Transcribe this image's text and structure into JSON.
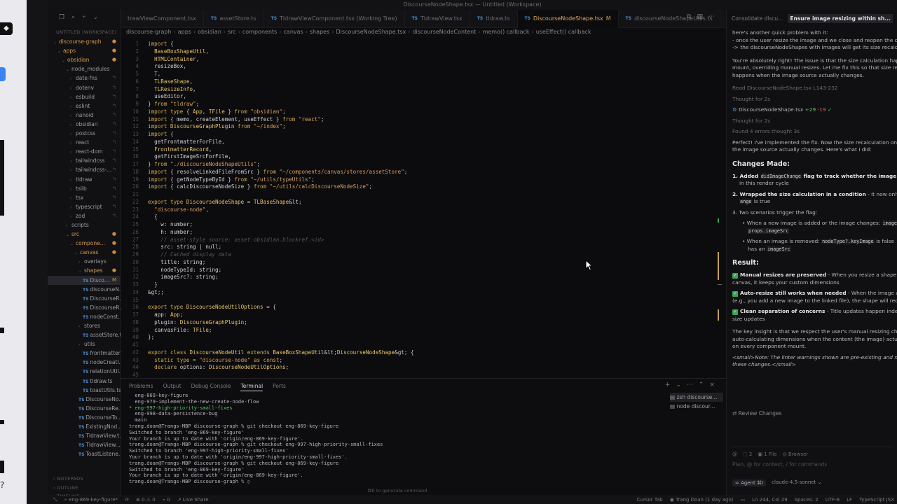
{
  "window": {
    "title": "DiscourseNodeShape.tsx — Untitled (Workspace)"
  },
  "explorer": {
    "workspace_label": "UNTITLED (WORKSPACE)",
    "rows": [
      {
        "label": "discourse-graph",
        "indent": 0,
        "kind": "folder-open",
        "dec": "●"
      },
      {
        "label": "apps",
        "indent": 1,
        "kind": "folder-open",
        "dec": "●"
      },
      {
        "label": "obsidian",
        "indent": 2,
        "kind": "folder-open",
        "dec": "●"
      },
      {
        "label": "node_modules",
        "indent": 3,
        "kind": "folder-open",
        "dec": ""
      },
      {
        "label": "date-fns",
        "indent": 4,
        "kind": "folder",
        "dec": "↰"
      },
      {
        "label": "dotenv",
        "indent": 4,
        "kind": "folder",
        "dec": "↰"
      },
      {
        "label": "esbuild",
        "indent": 4,
        "kind": "folder",
        "dec": "↰"
      },
      {
        "label": "eslint",
        "indent": 4,
        "kind": "folder",
        "dec": "↰"
      },
      {
        "label": "nanoid",
        "indent": 4,
        "kind": "folder",
        "dec": "↰"
      },
      {
        "label": "obsidian",
        "indent": 4,
        "kind": "folder",
        "dec": "↰"
      },
      {
        "label": "postcss",
        "indent": 4,
        "kind": "folder",
        "dec": "↰"
      },
      {
        "label": "react",
        "indent": 4,
        "kind": "folder",
        "dec": "↰"
      },
      {
        "label": "react-dom",
        "indent": 4,
        "kind": "folder",
        "dec": "↰"
      },
      {
        "label": "tailwindcss",
        "indent": 4,
        "kind": "folder",
        "dec": "↰"
      },
      {
        "label": "tailwindcss-...",
        "indent": 4,
        "kind": "folder",
        "dec": "↰"
      },
      {
        "label": "tldraw",
        "indent": 4,
        "kind": "folder",
        "dec": "↰"
      },
      {
        "label": "tslib",
        "indent": 4,
        "kind": "folder",
        "dec": "↰"
      },
      {
        "label": "tsx",
        "indent": 4,
        "kind": "folder",
        "dec": "↰"
      },
      {
        "label": "typescript",
        "indent": 4,
        "kind": "folder",
        "dec": "↰"
      },
      {
        "label": "zod",
        "indent": 4,
        "kind": "folder",
        "dec": "↰"
      },
      {
        "label": "scripts",
        "indent": 3,
        "kind": "folder",
        "dec": ""
      },
      {
        "label": "src",
        "indent": 3,
        "kind": "folder-open",
        "dec": "●"
      },
      {
        "label": "compone...",
        "indent": 4,
        "kind": "folder-open",
        "dec": "●"
      },
      {
        "label": "canvas",
        "indent": 5,
        "kind": "folder-open",
        "dec": "●"
      },
      {
        "label": "overlays",
        "indent": 6,
        "kind": "folder",
        "dec": ""
      },
      {
        "label": "shapes",
        "indent": 6,
        "kind": "folder-open",
        "dec": "●"
      },
      {
        "label": "Disco...",
        "indent": 7,
        "kind": "ts-sel",
        "dec": "M"
      },
      {
        "label": "discourseN...",
        "indent": 7,
        "kind": "ts",
        "dec": ""
      },
      {
        "label": "DiscourseR...",
        "indent": 7,
        "kind": "ts",
        "dec": ""
      },
      {
        "label": "DiscourseR...",
        "indent": 7,
        "kind": "ts",
        "dec": ""
      },
      {
        "label": "nodeConst...",
        "indent": 7,
        "kind": "ts",
        "dec": ""
      },
      {
        "label": "stores",
        "indent": 6,
        "kind": "folder",
        "dec": ""
      },
      {
        "label": "assetStore.ts",
        "indent": 7,
        "kind": "ts",
        "dec": ""
      },
      {
        "label": "utils",
        "indent": 6,
        "kind": "folder",
        "dec": ""
      },
      {
        "label": "frontmatter...",
        "indent": 7,
        "kind": "ts",
        "dec": ""
      },
      {
        "label": "nodeCreati...",
        "indent": 7,
        "kind": "ts",
        "dec": ""
      },
      {
        "label": "relationUtil...",
        "indent": 7,
        "kind": "ts",
        "dec": ""
      },
      {
        "label": "tldraw.ts",
        "indent": 7,
        "kind": "ts",
        "dec": ""
      },
      {
        "label": "toastUtils.ts",
        "indent": 7,
        "kind": "ts",
        "dec": ""
      },
      {
        "label": "DiscourseNo...",
        "indent": 6,
        "kind": "ts",
        "dec": ""
      },
      {
        "label": "DiscourseRe...",
        "indent": 6,
        "kind": "ts",
        "dec": ""
      },
      {
        "label": "DiscourseTo...",
        "indent": 6,
        "kind": "ts",
        "dec": ""
      },
      {
        "label": "ExistingNod...",
        "indent": 6,
        "kind": "ts",
        "dec": ""
      },
      {
        "label": "TldrawView.t...",
        "indent": 6,
        "kind": "ts",
        "dec": ""
      },
      {
        "label": "TldrawView...",
        "indent": 6,
        "kind": "ts",
        "dec": ""
      },
      {
        "label": "ToastListene...",
        "indent": 6,
        "kind": "ts",
        "dec": ""
      }
    ],
    "sections": [
      "NOTEPADS",
      "OUTLINE",
      "TIMELINE"
    ]
  },
  "tabs": [
    {
      "label": "trawViewComponent.tsx",
      "ts": false,
      "active": false
    },
    {
      "label": "assetStore.ts",
      "ts": true,
      "active": false
    },
    {
      "label": "TldrawViewComponent.tsx (Working Tree)",
      "ts": true,
      "active": false
    },
    {
      "label": "TldrawView.tsx",
      "ts": true,
      "active": false
    },
    {
      "label": "tldraw.ts",
      "ts": true,
      "active": false
    },
    {
      "label": "DiscourseNodeShape.tsx",
      "ts": true,
      "active": true,
      "mod": "M"
    },
    {
      "label": "discourseNodeShapeUtils.ts",
      "ts": true,
      "active": false
    }
  ],
  "breadcrumb": [
    "discourse-graph",
    "apps",
    "obsidian",
    "src",
    "components",
    "canvas",
    "shapes",
    "DiscourseNodeShape.tsx",
    "discourseNodeContent",
    "memo() callback",
    "useEffect() callback"
  ],
  "code": [
    {
      "n": "1",
      "t": "import {"
    },
    {
      "n": "2",
      "t": "  BaseBoxShapeUtil,"
    },
    {
      "n": "3",
      "t": "  HTMLContainer,"
    },
    {
      "n": "4",
      "t": "  resizeBox,"
    },
    {
      "n": "5",
      "t": "  T,"
    },
    {
      "n": "6",
      "t": "  TLBaseShape,"
    },
    {
      "n": "7",
      "t": "  TLResizeInfo,"
    },
    {
      "n": "8",
      "t": "  useEditor,"
    },
    {
      "n": "9",
      "t": "} from \"tldraw\";"
    },
    {
      "n": "10",
      "t": "import type { App, TFile } from \"obsidian\";"
    },
    {
      "n": "11",
      "t": "import { memo, createElement, useEffect } from \"react\";"
    },
    {
      "n": "12",
      "t": "import DiscourseGraphPlugin from \"~/index\";"
    },
    {
      "n": "13",
      "t": "import {"
    },
    {
      "n": "14",
      "t": "  getFrontmatterForFile,"
    },
    {
      "n": "15",
      "t": "  FrontmatterRecord,"
    },
    {
      "n": "16",
      "t": "  getFirstImageSrcForFile,"
    },
    {
      "n": "17",
      "t": "} from \"./discourseNodeShapeUtils\";"
    },
    {
      "n": "18",
      "t": "import { resolveLinkedFileFromSrc } from \"~/components/canvas/stores/assetStore\";"
    },
    {
      "n": "19",
      "t": "import { getNodeTypeById } from \"~/utils/typeUtils\";"
    },
    {
      "n": "20",
      "t": "import { calcDiscourseNodeSize } from \"~/utils/calcDiscourseNodeSize\";"
    },
    {
      "n": "21",
      "t": ""
    },
    {
      "n": "22",
      "t": "export type DiscourseNodeShape = TLBaseShape<"
    },
    {
      "n": "23",
      "t": "  \"discourse-node\","
    },
    {
      "n": "24",
      "t": "  {"
    },
    {
      "n": "25",
      "t": "    w: number;"
    },
    {
      "n": "26",
      "t": "    h: number;"
    },
    {
      "n": "27",
      "t": "    // asset-style source: asset:obsidian.blockref.<id>"
    },
    {
      "n": "28",
      "t": "    src: string | null;"
    },
    {
      "n": "29",
      "t": "    // Cached display data"
    },
    {
      "n": "30",
      "t": "    title: string;"
    },
    {
      "n": "31",
      "t": "    nodeTypeId: string;"
    },
    {
      "n": "32",
      "t": "    imageSrc?: string;"
    },
    {
      "n": "33",
      "t": "  }"
    },
    {
      "n": "34",
      "t": ">;"
    },
    {
      "n": "35",
      "t": ""
    },
    {
      "n": "36",
      "t": "export type DiscourseNodeUtilOptions = {"
    },
    {
      "n": "37",
      "t": "  app: App;"
    },
    {
      "n": "38",
      "t": "  plugin: DiscourseGraphPlugin;"
    },
    {
      "n": "39",
      "t": "  canvasFile: TFile;"
    },
    {
      "n": "40",
      "t": "};"
    },
    {
      "n": "41",
      "t": ""
    },
    {
      "n": "42",
      "t": "export class DiscourseNodeUtil extends BaseBoxShapeUtil<DiscourseNodeShape> {"
    },
    {
      "n": "43",
      "t": "  static type = \"discourse-node\" as const;"
    },
    {
      "n": "44",
      "t": "  declare options: DiscourseNodeUtilOptions;"
    },
    {
      "n": "45",
      "t": ""
    }
  ],
  "panel": {
    "tabs": [
      "Problems",
      "Output",
      "Debug Console",
      "Terminal",
      "Ports"
    ],
    "active_tab": "Terminal",
    "terminal_lines": [
      {
        "t": "  eng-869-key-figure",
        "c": ""
      },
      {
        "t": "  eng-979-implement-the-new-create-node-flow",
        "c": ""
      },
      {
        "t": "* eng-997-high-priority-small-fixes",
        "c": "green"
      },
      {
        "t": "  eng-998-data-persistence-bug",
        "c": ""
      },
      {
        "t": "  main",
        "c": ""
      },
      {
        "t": "trang.doan@Trangs-MBP discourse-graph % git checkout eng-869-key-figure",
        "c": ""
      },
      {
        "t": "Switched to branch 'eng-869-key-figure'",
        "c": ""
      },
      {
        "t": "Your branch is up to date with 'origin/eng-869-key-figure'.",
        "c": ""
      },
      {
        "t": "trang.doan@Trangs-MBP discourse-graph % git checkout eng-997-high-priority-small-fixes",
        "c": ""
      },
      {
        "t": "Switched to branch 'eng-997-high-priority-small-fixes'",
        "c": ""
      },
      {
        "t": "Your branch is up to date with 'origin/eng-997-high-priority-small-fixes'.",
        "c": ""
      },
      {
        "t": "trang.doan@Trangs-MBP discourse-graph % git checkout eng-869-key-figure",
        "c": ""
      },
      {
        "t": "Switched to branch 'eng-869-key-figure'",
        "c": ""
      },
      {
        "t": "Your branch is up to date with 'origin/eng-869-key-figure'.",
        "c": ""
      },
      {
        "t": "trang.doan@Trangs-MBP discourse-graph % ▯",
        "c": ""
      }
    ],
    "cmdk_hint": "⌘K to generate command",
    "terminal_list": [
      {
        "label": "zsh  discourse...",
        "sel": true
      },
      {
        "label": "node  discour...",
        "sel": false
      }
    ]
  },
  "chat": {
    "tabs": [
      "Consolidate discu...",
      "Ensure image resizing within sh..."
    ],
    "user_msg": [
      "here's another quick problem with it:",
      "- once the user resize the image and we close and reopen the can",
      "-> the discourseNodeShapes with images will get its size recalcul"
    ],
    "reply_intro": [
      "You're absolutely right! The issue is that the size calculation happ",
      "mount, overriding manual resizes. Let me fix this so that size reca",
      "happens when the image source actually changes."
    ],
    "read_line": "Read DiscourseNodeShape.tsx L143-232",
    "thought_1": "Thought for 2s",
    "edit_file": "DiscourseNodeShape.tsx",
    "edit_add": "+29",
    "edit_del": "-19",
    "thought_2": "Thought for 2s",
    "errors_line": "Found 4 errors  thought 3s",
    "perfect": [
      "Perfect! I've implemented the fix. Now the size recalculation only",
      "the image source actually changes. Here's what I did:"
    ],
    "changes_heading": "Changes Made:",
    "changes": {
      "c1_pre": "1. Added ",
      "c1_code": "didImageChange",
      "c1_post": " flag to track whether the image sourc",
      "c1_l2": "in this render cycle",
      "c2_pre": "2. Wrapped the size calculation in a condition",
      "c2_post": " - it now only runs",
      "c2_code": "ange",
      "c2_l2": " is true",
      "c3": "3. Two scenarios trigger the flag:",
      "b1": "When a new image is added or the image changes: ",
      "b1_code": "imageS",
      "b1_l2": "props.imageSrc",
      "b2": "When an image is removed: ",
      "b2_code": "nodeType?.keyImage",
      "b2_post": " is false",
      "b2_l2_pre": "has an ",
      "b2_l2_code": "imageSrc"
    },
    "result_heading": "Result:",
    "results": {
      "r1_b": "Manual resizes are preserved",
      "r1": " - When you resize a shape and",
      "r1_l2": "canvas, it keeps your custom dimensions",
      "r2_b": "Auto-resize still works when needed",
      "r2": " - When the image actua",
      "r2_l2": "(e.g., you add a new image to the linked file), the shape will recalc",
      "r3_b": "Clean separation of concerns",
      "r3": " - Title updates happen indeper",
      "r3_l2": "size updates"
    },
    "insight": [
      "The key insight is that we respect the user's manual resizing choic",
      "auto-calculating dimensions when the content (the image) actual",
      "on every component mount."
    ],
    "small_note_1": "<small>Note: The linter warnings shown are pre-existing and not",
    "small_note_2": "these changes.</small>",
    "review_changes": "Review Changes",
    "input_files": "1 File",
    "input_count": "2",
    "input_browser": "Browser",
    "input_placeholder": "Plan, @ for context, / for commands",
    "agent_label": "Agent",
    "agent_shortcut": "⌘I",
    "model": "claude-4.5-sonnet"
  },
  "status": {
    "branch": "eng-869-key-figure*",
    "errors": "0",
    "warnings": "0",
    "ports": "0",
    "live_share": "Live Share",
    "cursor_tab": "Cursor Tab",
    "blame": "Trang Doan (1 day ago)",
    "position": "Ln 244, Col 29",
    "spaces": "Spaces: 2",
    "encoding": "UTF-8",
    "eol": "LF",
    "language": "TypeScript JSX"
  }
}
